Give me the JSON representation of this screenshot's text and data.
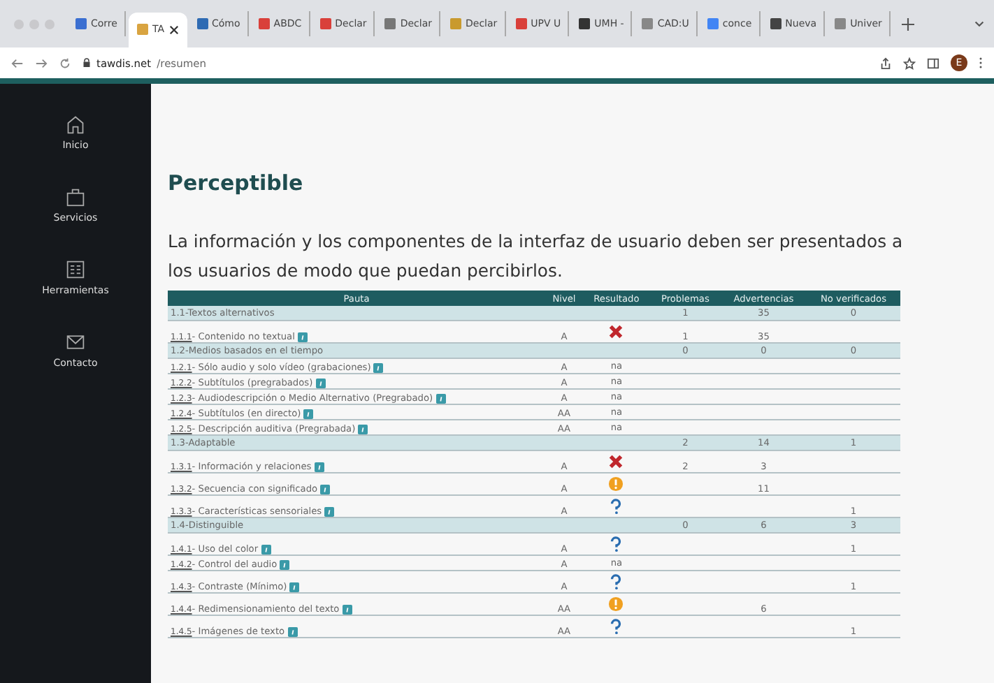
{
  "browser": {
    "tabs": [
      {
        "title": "Corre",
        "color": "#3b6fd1",
        "selected": false,
        "closable": false
      },
      {
        "title": "TA",
        "color": "#d9a441",
        "selected": true,
        "closable": true
      },
      {
        "title": "Cómo",
        "color": "#2f6bb3",
        "selected": false,
        "closable": false
      },
      {
        "title": "ABDC",
        "color": "#d9403a",
        "selected": false,
        "closable": false
      },
      {
        "title": "Declar",
        "color": "#d9403a",
        "selected": false,
        "closable": false
      },
      {
        "title": "Declar",
        "color": "#777777",
        "selected": false,
        "closable": false
      },
      {
        "title": "Declar",
        "color": "#c99a2e",
        "selected": false,
        "closable": false
      },
      {
        "title": "UPV U",
        "color": "#d9403a",
        "selected": false,
        "closable": false
      },
      {
        "title": "UMH -",
        "color": "#333333",
        "selected": false,
        "closable": false
      },
      {
        "title": "CAD:U",
        "color": "#888888",
        "selected": false,
        "closable": false
      },
      {
        "title": "conce",
        "color": "#4285f4",
        "selected": false,
        "closable": false
      },
      {
        "title": "Nueva",
        "color": "#444444",
        "selected": false,
        "closable": false
      },
      {
        "title": "Univer",
        "color": "#888888",
        "selected": false,
        "closable": false
      }
    ],
    "url_host": "tawdis.net",
    "url_path": "/resumen",
    "profile_initial": "E"
  },
  "sidebar": {
    "items": [
      {
        "label": "Inicio"
      },
      {
        "label": "Servicios"
      },
      {
        "label": "Herramientas"
      },
      {
        "label": "Contacto"
      }
    ]
  },
  "heading": "Perceptible",
  "intro": "La información y los componentes de la interfaz de usuario deben ser presentados a los usuarios de modo que puedan percibirlos.",
  "table": {
    "columns": [
      "Pauta",
      "Nivel",
      "Resultado",
      "Problemas",
      "Advertencias",
      "No verificados"
    ],
    "rows": [
      {
        "kind": "group",
        "title": "1.1-Textos alternativos",
        "problems": "1",
        "warnings": "35",
        "unverified": "0"
      },
      {
        "kind": "item",
        "code": "1.1.1",
        "title": " - Contenido no textual",
        "level": "A",
        "result": {
          "kind": "fail"
        },
        "problems": "1",
        "warnings": "35",
        "unverified": ""
      },
      {
        "kind": "group",
        "title": "1.2-Medios basados en el tiempo",
        "problems": "0",
        "warnings": "0",
        "unverified": "0"
      },
      {
        "kind": "item",
        "code": "1.2.1",
        "title": " - Sólo audio y solo vídeo (grabaciones)",
        "level": "A",
        "result": {
          "kind": "text",
          "text": "na"
        },
        "problems": "",
        "warnings": "",
        "unverified": ""
      },
      {
        "kind": "item",
        "code": "1.2.2",
        "title": " - Subtítulos (pregrabados)",
        "level": "A",
        "result": {
          "kind": "text",
          "text": "na"
        },
        "problems": "",
        "warnings": "",
        "unverified": ""
      },
      {
        "kind": "item",
        "code": "1.2.3",
        "title": " - Audiodescripción o Medio Alternativo (Pregrabado)",
        "level": "A",
        "result": {
          "kind": "text",
          "text": "na"
        },
        "problems": "",
        "warnings": "",
        "unverified": ""
      },
      {
        "kind": "item",
        "code": "1.2.4",
        "title": " - Subtítulos (en directo)",
        "level": "AA",
        "result": {
          "kind": "text",
          "text": "na"
        },
        "problems": "",
        "warnings": "",
        "unverified": ""
      },
      {
        "kind": "item",
        "code": "1.2.5",
        "title": " - Descripción auditiva (Pregrabada)",
        "level": "AA",
        "result": {
          "kind": "text",
          "text": "na"
        },
        "problems": "",
        "warnings": "",
        "unverified": ""
      },
      {
        "kind": "group",
        "title": "1.3-Adaptable",
        "problems": "2",
        "warnings": "14",
        "unverified": "1"
      },
      {
        "kind": "item",
        "code": "1.3.1",
        "title": " - Información y relaciones",
        "level": "A",
        "result": {
          "kind": "fail"
        },
        "problems": "2",
        "warnings": "3",
        "unverified": ""
      },
      {
        "kind": "item",
        "code": "1.3.2",
        "title": " - Secuencia con significado",
        "level": "A",
        "result": {
          "kind": "warning"
        },
        "problems": "",
        "warnings": "11",
        "unverified": ""
      },
      {
        "kind": "item",
        "code": "1.3.3",
        "title": " - Características sensoriales",
        "level": "A",
        "result": {
          "kind": "review"
        },
        "problems": "",
        "warnings": "",
        "unverified": "1"
      },
      {
        "kind": "group",
        "title": "1.4-Distinguible",
        "problems": "0",
        "warnings": "6",
        "unverified": "3"
      },
      {
        "kind": "item",
        "code": "1.4.1",
        "title": " - Uso del color",
        "level": "A",
        "result": {
          "kind": "review"
        },
        "problems": "",
        "warnings": "",
        "unverified": "1"
      },
      {
        "kind": "item",
        "code": "1.4.2",
        "title": " - Control del audio",
        "level": "A",
        "result": {
          "kind": "text",
          "text": "na"
        },
        "problems": "",
        "warnings": "",
        "unverified": ""
      },
      {
        "kind": "item",
        "code": "1.4.3",
        "title": " - Contraste (Mínimo)",
        "level": "A",
        "result": {
          "kind": "review"
        },
        "problems": "",
        "warnings": "",
        "unverified": "1"
      },
      {
        "kind": "item",
        "code": "1.4.4",
        "title": " - Redimensionamiento del texto",
        "level": "AA",
        "result": {
          "kind": "warning"
        },
        "problems": "",
        "warnings": "6",
        "unverified": ""
      },
      {
        "kind": "item",
        "code": "1.4.5",
        "title": " - Imágenes de texto",
        "level": "AA",
        "result": {
          "kind": "review"
        },
        "problems": "",
        "warnings": "",
        "unverified": "1"
      }
    ]
  }
}
